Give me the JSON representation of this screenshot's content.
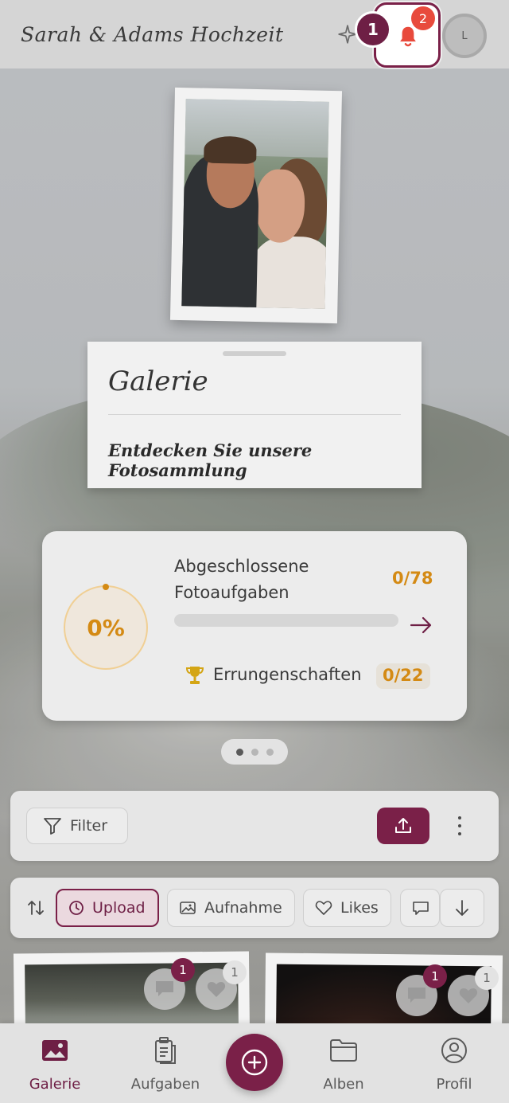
{
  "header": {
    "app_title": "Sarah & Adams Hochzeit",
    "notification_count": "2",
    "tour_step": "1",
    "avatar_initial": "L"
  },
  "gallery": {
    "title": "Galerie",
    "subtitle": "Entdecken Sie unsere Fotosammlung"
  },
  "progress": {
    "percent_label": "0%",
    "tasks_label": "Abgeschlossene Fotoaufgaben",
    "tasks_count": "0/78",
    "tasks_progress": 0,
    "achievements_label": "Errungenschaften",
    "achievements_count": "0/22"
  },
  "pager": {
    "pages": 3,
    "active": 0
  },
  "toolbar": {
    "filter_label": "Filter"
  },
  "sort": {
    "chips": [
      {
        "label": "Upload",
        "active": true
      },
      {
        "label": "Aufnahme",
        "active": false
      },
      {
        "label": "Likes",
        "active": false
      }
    ]
  },
  "photos": [
    {
      "comments": "1",
      "likes": "1"
    },
    {
      "comments": "1",
      "likes": "1"
    }
  ],
  "nav": {
    "items": [
      {
        "label": "Galerie"
      },
      {
        "label": "Aufgaben"
      },
      {
        "label": "Alben"
      },
      {
        "label": "Profil"
      }
    ]
  },
  "colors": {
    "brand": "#7a2048",
    "accent_orange": "#d48a14",
    "badge_red": "#e84a3c"
  }
}
